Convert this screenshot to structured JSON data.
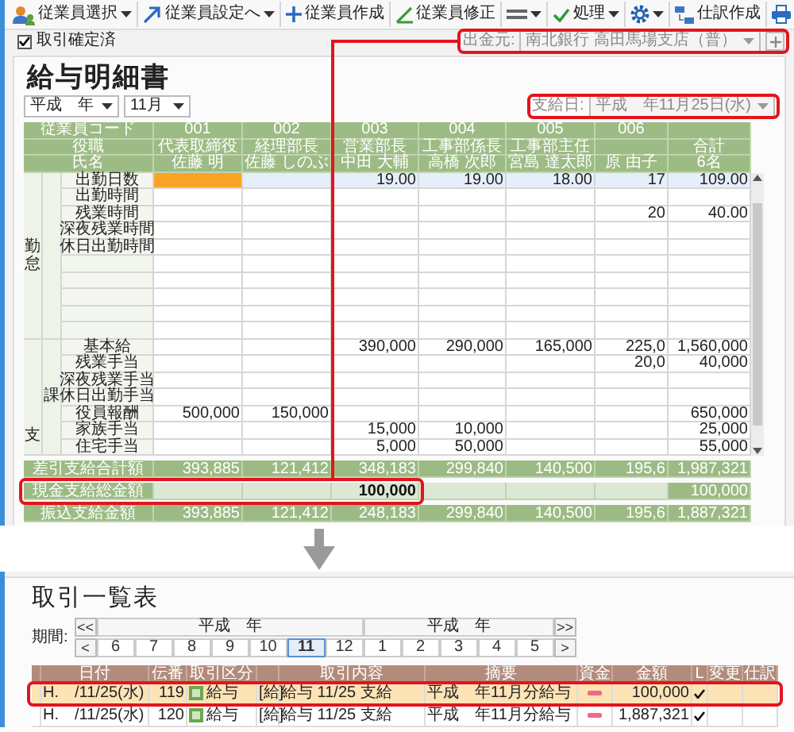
{
  "payroll_window": {
    "toolbar": {
      "left": [
        {
          "kind": "people",
          "label": "従業員選択",
          "dropdown": true
        },
        {
          "kind": "arrow",
          "label": "従業員設定へ",
          "dropdown": true
        },
        {
          "kind": "plus",
          "label": "従業員作成",
          "dropdown": false
        },
        {
          "kind": "pen",
          "label": "従業員修正",
          "dropdown": false
        },
        {
          "kind": "lines",
          "dropdown": true
        }
      ],
      "right": [
        {
          "kind": "check",
          "label": "処理",
          "dropdown": true
        },
        {
          "kind": "gear",
          "dropdown": true
        },
        {
          "kind": "journal",
          "label": "仕訳作成",
          "dropdown": false
        },
        {
          "kind": "printer",
          "dropdown": false
        }
      ]
    },
    "confirmed_checkbox": {
      "label": "取引確定済",
      "checked": true
    },
    "payment_source": {
      "label": "出金元:",
      "value": "南北銀行 高田馬場支店（普）",
      "disabled": true,
      "highlighted": true
    },
    "title": "給与明細書",
    "year_select": "平成　年",
    "month_select": "11月",
    "pay_date": {
      "label": "支給日:",
      "value": "平成　年11月25日(水)",
      "disabled": true,
      "highlighted": true
    },
    "table": {
      "header_rows": [
        {
          "label": "従業員コード",
          "cells": [
            "001",
            "002",
            "003",
            "004",
            "005",
            "006",
            null
          ]
        },
        {
          "label": "役職",
          "cells": [
            "代表取締役",
            "経理部長",
            "営業部長",
            "工事部係長",
            "工事部主任",
            null,
            "合計"
          ]
        },
        {
          "label": "氏名",
          "cells": [
            "佐藤 明",
            "佐藤 しのぶ",
            "中田 大輔",
            "高橋 次郎",
            "宮島 達太郎",
            "原 由子",
            "6名"
          ]
        }
      ],
      "sections": [
        {
          "label": "勤怠",
          "rows": [
            {
              "label": "出勤日数",
              "selected": true,
              "cells": [
                {
                  "focused": true
                },
                null,
                "19.00",
                "19.00",
                "18.00",
                "17",
                "109.00"
              ]
            },
            {
              "label": "出勤時間",
              "selected": false,
              "cells": []
            },
            {
              "label": "残業時間",
              "selected": false,
              "cells": [
                null,
                null,
                null,
                null,
                null,
                "20",
                "40.00"
              ]
            },
            {
              "label": "深夜残業時間",
              "selected": false,
              "cells": []
            },
            {
              "label": "休日出勤時間",
              "selected": false,
              "cells": []
            },
            {
              "selected": false,
              "cells": []
            },
            {
              "selected": false,
              "cells": []
            },
            {
              "selected": false,
              "cells": []
            },
            {
              "selected": false,
              "cells": []
            },
            {
              "selected": false,
              "cells": []
            }
          ]
        },
        {
          "label": "支",
          "sublabel": "課",
          "rows": [
            {
              "label": "基本給",
              "selected": false,
              "cells": [
                null,
                null,
                "390,000",
                "290,000",
                "165,000",
                "225,0",
                "1,560,000"
              ]
            },
            {
              "label": "残業手当",
              "selected": false,
              "cells": [
                null,
                null,
                null,
                null,
                null,
                "20,0",
                "40,000"
              ]
            },
            {
              "label": "深夜残業手当",
              "selected": false,
              "cells": []
            },
            {
              "label": "休日出勤手当",
              "selected": false,
              "cells": []
            },
            {
              "label": "役員報酬",
              "selected": false,
              "cells": [
                "500,000",
                "150,000",
                null,
                null,
                null,
                null,
                "650,000"
              ]
            },
            {
              "label": "家族手当",
              "selected": false,
              "cells": [
                null,
                null,
                "15,000",
                "10,000",
                null,
                null,
                "25,000"
              ]
            },
            {
              "label": "住宅手当",
              "selected": false,
              "cells": [
                null,
                null,
                "5,000",
                "50,000",
                null,
                null,
                "55,000"
              ]
            }
          ]
        }
      ],
      "footer_rows": [
        {
          "kind": "total",
          "label": "差引支給合計額",
          "highlighted": false,
          "cells": [
            "393,885",
            "121,412",
            "348,183",
            "299,840",
            "140,500",
            "195,6",
            "1,987,321"
          ]
        },
        {
          "kind": "entry",
          "label": "現金支給総金額",
          "highlighted": true,
          "cells": [
            null,
            null,
            "100,000",
            null,
            null,
            null,
            "100,000"
          ]
        },
        {
          "kind": "total",
          "label": "振込支給金額",
          "highlighted": false,
          "cells": [
            "393,885",
            "121,412",
            "248,183",
            "299,840",
            "140,500",
            "195,6",
            "1,887,321"
          ]
        }
      ]
    }
  },
  "ledger_window": {
    "title": "取引一覧表",
    "period": {
      "label": "期間:",
      "prev_year": "<<",
      "next_year": ">>",
      "prev": "<",
      "next": ">",
      "years": [
        {
          "label": "平成　年",
          "months": [
            {
              "label": "6",
              "selected": false
            },
            {
              "label": "7",
              "selected": false
            },
            {
              "label": "8",
              "selected": false
            },
            {
              "label": "9",
              "selected": false
            },
            {
              "label": "10",
              "selected": false
            },
            {
              "label": "11",
              "selected": true
            },
            {
              "label": "12",
              "selected": false
            }
          ]
        },
        {
          "label": "平成　年",
          "months": [
            {
              "label": "1",
              "selected": false
            },
            {
              "label": "2",
              "selected": false
            },
            {
              "label": "3",
              "selected": false
            },
            {
              "label": "4",
              "selected": false
            },
            {
              "label": "5",
              "selected": false
            }
          ]
        }
      ]
    },
    "table": {
      "columns": [
        null,
        "日付",
        "伝番",
        "取引区分",
        null,
        "取引内容",
        "摘要",
        "資金",
        "金額",
        "L",
        "変更",
        "仕訳"
      ],
      "rows": [
        {
          "selected": true,
          "highlighted": true,
          "date": "H.　/11/25(水)",
          "number": "119",
          "category": "給与",
          "tag": "[給]",
          "content": "給与 11/25 支給",
          "memo": "平成　年11月分給与",
          "amount": "100,000",
          "linked": true
        },
        {
          "selected": false,
          "highlighted": false,
          "date": "H.　/11/25(水)",
          "number": "120",
          "category": "給与",
          "tag": "[給]",
          "content": "給与 11/25 支給",
          "memo": "平成　年11月分給与",
          "amount": "1,887,321",
          "linked": true
        }
      ]
    }
  }
}
